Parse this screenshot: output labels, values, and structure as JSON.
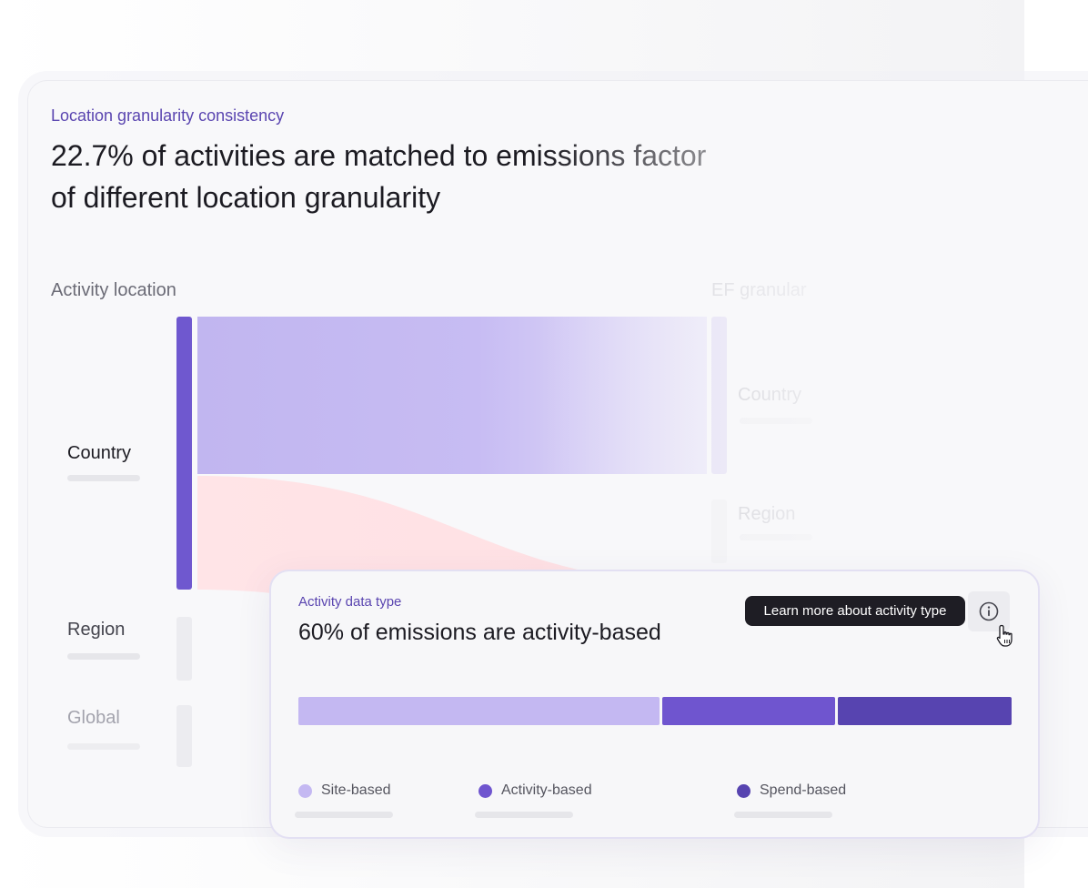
{
  "location_card": {
    "kicker": "Location granularity consistency",
    "headline_line1": "22.7% of activities are matched to emissions factor",
    "headline_line2": "of different location granularity",
    "left_column_label": "Activity location",
    "right_column_label": "EF granular",
    "left_rows": [
      {
        "label": "Country"
      },
      {
        "label": "Region"
      },
      {
        "label": "Global"
      }
    ],
    "right_rows": [
      {
        "label": "Country"
      },
      {
        "label": "Region"
      }
    ],
    "colors": {
      "node_purple": "#6f58cf",
      "flow_lavender": "#c1b6f0",
      "flow_pink": "#ffe3e6"
    }
  },
  "activity_card": {
    "kicker": "Activity data type",
    "title": "60% of emissions are activity-based",
    "tooltip": "Learn more about activity type",
    "info_icon": "info-icon",
    "segments": [
      {
        "label": "Site-based",
        "color": "#c4b8f2"
      },
      {
        "label": "Activity-based",
        "color": "#6f55cf"
      },
      {
        "label": "Spend-based",
        "color": "#5744b0"
      }
    ]
  }
}
